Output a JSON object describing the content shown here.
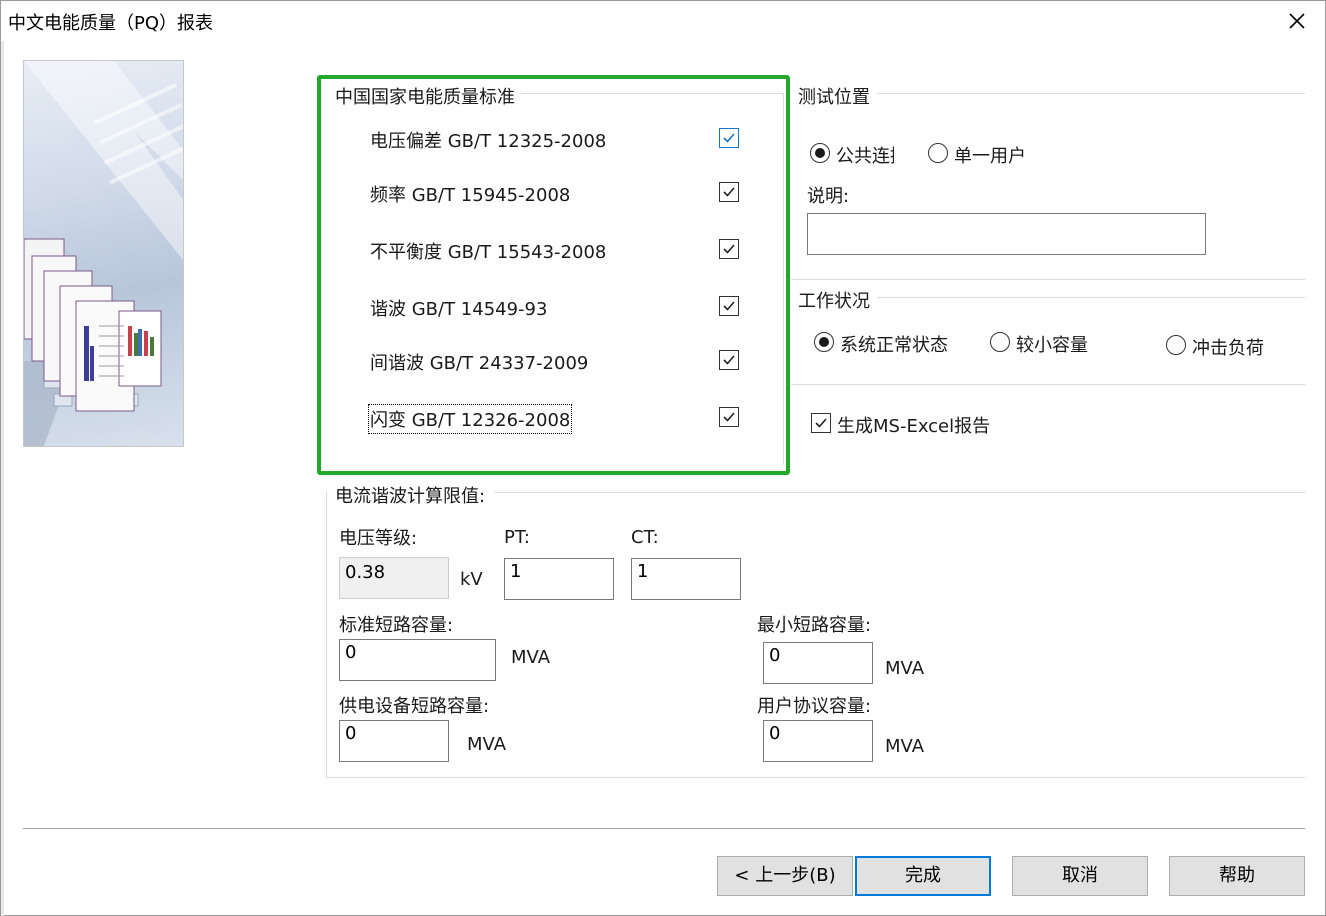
{
  "window": {
    "title": "中文电能质量（PQ）报表"
  },
  "standards": {
    "group_title": "中国国家电能质量标准",
    "items": [
      {
        "label": "电压偏差  GB/T 12325-2008",
        "checked": true
      },
      {
        "label": "频率 GB/T 15945-2008",
        "checked": true
      },
      {
        "label": "不平衡度 GB/T 15543-2008",
        "checked": true
      },
      {
        "label": "谐波 GB/T 14549-93",
        "checked": true
      },
      {
        "label": "间谐波 GB/T 24337-2009",
        "checked": true
      },
      {
        "label": "闪变 GB/T 12326-2008",
        "checked": true
      }
    ]
  },
  "location": {
    "group_title": "测试位置",
    "options": [
      {
        "label": "公共连接",
        "selected": true
      },
      {
        "label": "单一用户",
        "selected": false
      }
    ],
    "desc_label": "说明:",
    "desc_value": ""
  },
  "condition": {
    "group_title": "工作状况",
    "options": [
      {
        "label": "系统正常状态",
        "selected": true
      },
      {
        "label": "较小容量",
        "selected": false
      },
      {
        "label": "冲击负荷",
        "selected": false
      }
    ]
  },
  "excel": {
    "label": "生成MS-Excel报告",
    "checked": true
  },
  "limits": {
    "group_title": "电流谐波计算限值:",
    "voltage_label": "电压等级:",
    "voltage_value": "0.38",
    "voltage_unit": "kV",
    "pt_label": "PT:",
    "pt_value": "1",
    "ct_label": "CT:",
    "ct_value": "1",
    "std_sc_label": "标准短路容量:",
    "std_sc_value": "0",
    "std_sc_unit": "MVA",
    "min_sc_label": "最小短路容量:",
    "min_sc_value": "0",
    "min_sc_unit": "MVA",
    "supply_sc_label": "供电设备短路容量:",
    "supply_sc_value": "0",
    "supply_sc_unit": "MVA",
    "user_cap_label": "用户协议容量:",
    "user_cap_value": "0",
    "user_cap_unit": "MVA"
  },
  "buttons": {
    "back": "< 上一步(B)",
    "finish": "完成",
    "cancel": "取消",
    "help": "帮助"
  }
}
